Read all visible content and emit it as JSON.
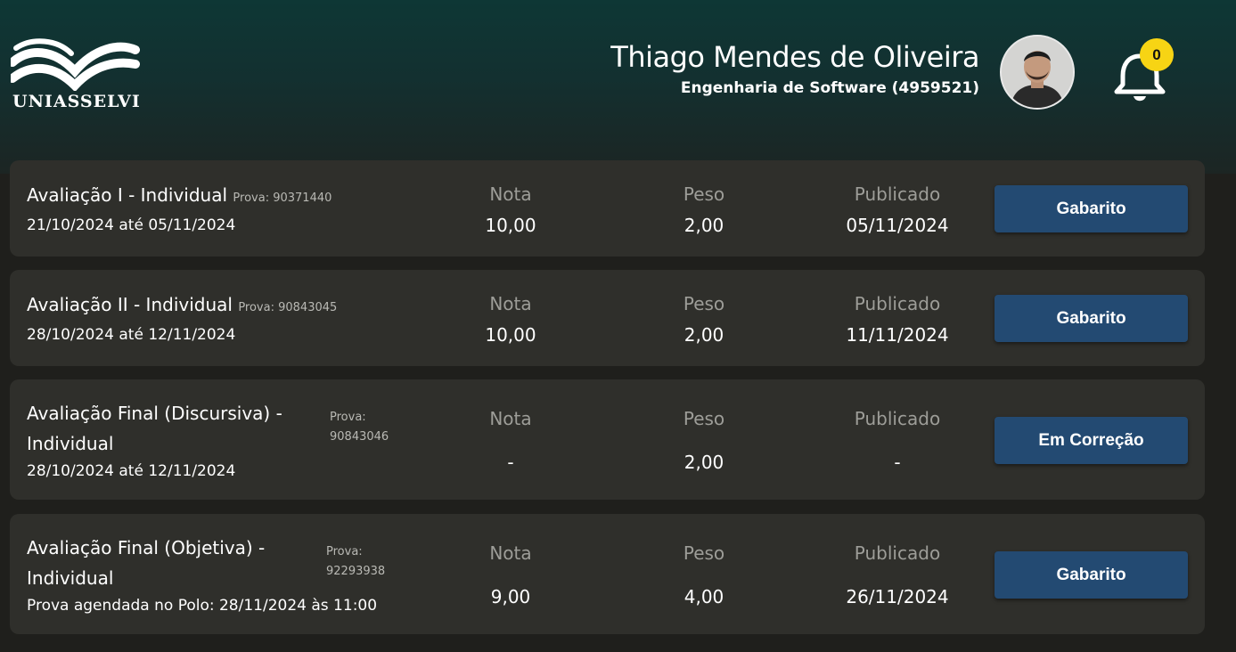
{
  "header": {
    "brand": "UNIASSELVI",
    "user_name": "Thiago Mendes de Oliveira",
    "user_course": "Engenharia de Software (4959521)",
    "notification_count": "0",
    "avatar_icon": "user-avatar-photo",
    "bell_icon": "bell-icon"
  },
  "columns": {
    "nota": "Nota",
    "peso": "Peso",
    "publicado": "Publicado"
  },
  "cards": [
    {
      "title": "Avaliação I - Individual",
      "prova": "Prova: 90371440",
      "dates": "21/10/2024 até 05/11/2024",
      "nota": "10,00",
      "peso": "2,00",
      "publicado": "05/11/2024",
      "button": "Gabarito"
    },
    {
      "title": "Avaliação II - Individual",
      "prova": "Prova: 90843045",
      "dates": "28/10/2024 até 12/11/2024",
      "nota": "10,00",
      "peso": "2,00",
      "publicado": "11/11/2024",
      "button": "Gabarito"
    },
    {
      "title_line1": "Avaliação Final (Discursiva) -",
      "title_line2": "Individual",
      "prova_line1": "Prova:",
      "prova_line2": "90843046",
      "dates": "28/10/2024 até 12/11/2024",
      "nota": "-",
      "peso": "2,00",
      "publicado": "-",
      "button": "Em Correção"
    },
    {
      "title_line1": "Avaliação Final (Objetiva) -",
      "title_line2": "Individual",
      "prova_line1": "Prova:",
      "prova_line2": "92293938",
      "dates": "Prova agendada no Polo: 28/11/2024 às 11:00",
      "nota": "9,00",
      "peso": "4,00",
      "publicado": "26/11/2024",
      "button": "Gabarito"
    }
  ],
  "colors": {
    "header_top": "#0e3735",
    "card_bg": "#2f2f2b",
    "page_bg": "#1f1f1c",
    "button_bg": "#234a72",
    "badge": "#f7d414"
  }
}
